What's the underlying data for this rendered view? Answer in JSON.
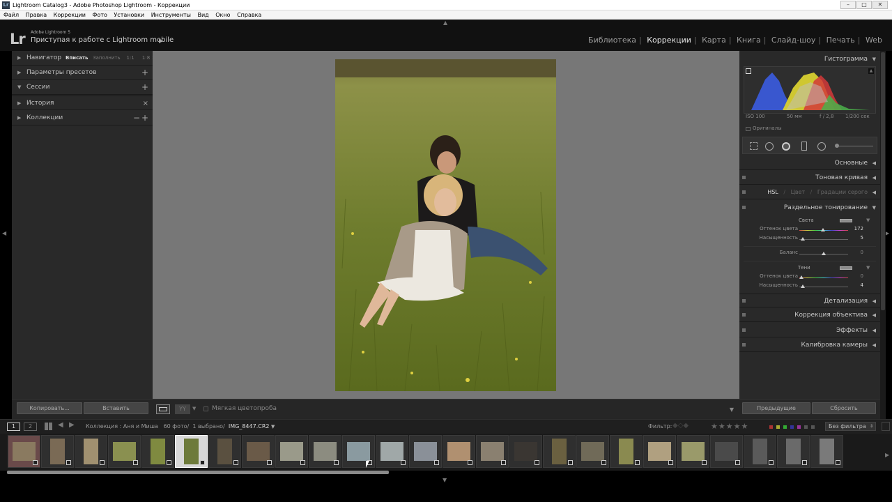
{
  "window": {
    "title": "Lightroom Catalog3 - Adobe Photoshop Lightroom - Коррекции",
    "icon_label": "Lr",
    "min": "–",
    "max": "□",
    "close": "✕"
  },
  "menu": [
    "Файл",
    "Правка",
    "Коррекции",
    "Фото",
    "Установки",
    "Инструменты",
    "Вид",
    "Окно",
    "Справка"
  ],
  "identity": {
    "logo": "Lr",
    "product": "Adobe Lightroom 5",
    "mobile_link": "Приступая к работе с Lightroom mobile",
    "play": "▶"
  },
  "modules": [
    "Библиотека",
    "Коррекции",
    "Карта",
    "Книга",
    "Слайд-шоу",
    "Печать",
    "Web"
  ],
  "active_module": "Коррекции",
  "left_panel": {
    "navigator": {
      "label": "Навигатор",
      "fit": "Вписать",
      "fill": "Заполнить",
      "one": "1:1",
      "ratio": "1:8",
      "arrows": "⇕"
    },
    "presets": {
      "label": "Параметры пресетов",
      "action": "+"
    },
    "snapshots": {
      "label": "Сессии",
      "action": "+"
    },
    "history": {
      "label": "История",
      "action": "×"
    },
    "collections": {
      "label": "Коллекции",
      "action_minus": "−",
      "action_plus": "+"
    },
    "copy_button": "Копировать...",
    "paste_button": "Вставить"
  },
  "toolbar": {
    "soft_proof": "Мягкая цветопроба"
  },
  "right_panel": {
    "histogram": {
      "label": "Гистограмма",
      "iso": "ISO 100",
      "focal": "50 мм",
      "aperture": "f / 2,8",
      "shutter": "1/200 сек",
      "originals": "Оригиналы"
    },
    "basic": "Основные",
    "tone_curve": "Тоновая кривая",
    "hsl": {
      "hsl": "HSL",
      "color": "Цвет",
      "gray": "Градации серого",
      "sep": "/"
    },
    "split_toning": {
      "label": "Раздельное тонирование",
      "highlights": "Света",
      "hl_hue_label": "Оттенок цвета",
      "hl_hue": "172",
      "hl_sat_label": "Насыщенность",
      "hl_sat": "5",
      "balance_label": "Баланс",
      "balance": "0",
      "shadows": "Тени",
      "sh_hue_label": "Оттенок цвета",
      "sh_hue": "0",
      "sh_sat_label": "Насыщенность",
      "sh_sat": "4"
    },
    "detail": "Детализация",
    "lens": "Коррекция объектива",
    "effects": "Эффекты",
    "calibration": "Калибровка камеры",
    "previous_button": "Предыдущие",
    "reset_button": "Сбросить"
  },
  "filmstrip_bar": {
    "screen1": "1",
    "screen2": "2",
    "collection": "Коллекция : Аня и Миша",
    "count": "60 фото/",
    "selected": "1 выбрано/",
    "filename": "IMG_8447.CR2",
    "filter_label": "Фильтр:",
    "stars": "★★★★★",
    "filter_value": "Без фильтра"
  },
  "colors": {
    "accent_active": "#e8e8e8",
    "panel_bg": "#292929",
    "center_bg": "#777777"
  }
}
